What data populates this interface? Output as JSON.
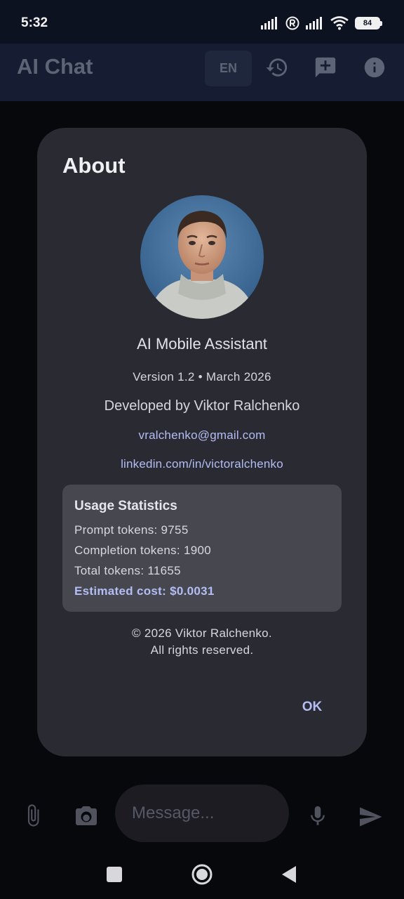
{
  "status_bar": {
    "time": "5:32",
    "battery": "84",
    "icons": [
      "signal-icon",
      "registered-icon",
      "signal-icon",
      "wifi-icon",
      "battery-icon"
    ]
  },
  "app_bar": {
    "title": "AI Chat",
    "language": "EN",
    "icons": [
      "history-icon",
      "new-chat-icon",
      "info-icon"
    ]
  },
  "dialog": {
    "title": "About",
    "app_name": "AI Mobile Assistant",
    "version": "Version 1.2 • March 2026",
    "developer": "Developed by Viktor Ralchenko",
    "email": "vralchenko@gmail.com",
    "linkedin": "linkedin.com/in/victoralchenko",
    "stats": {
      "title": "Usage Statistics",
      "prompt_tokens": "Prompt tokens: 9755",
      "completion_tokens": "Completion tokens: 1900",
      "total_tokens": "Total tokens: 11655",
      "estimated_cost": "Estimated cost: $0.0031"
    },
    "copyright_line1": "© 2026 Viktor Ralchenko.",
    "copyright_line2": "All rights reserved.",
    "ok_label": "OK"
  },
  "input_bar": {
    "placeholder": "Message...",
    "icons": [
      "attach-icon",
      "camera-icon",
      "mic-icon",
      "send-icon"
    ]
  },
  "nav_bar": {
    "icons": [
      "recents-icon",
      "home-icon",
      "back-icon"
    ]
  },
  "colors": {
    "accent": "#b4bdf4",
    "dialog_bg": "#2a2a32",
    "app_bar_bg": "#161d33"
  }
}
